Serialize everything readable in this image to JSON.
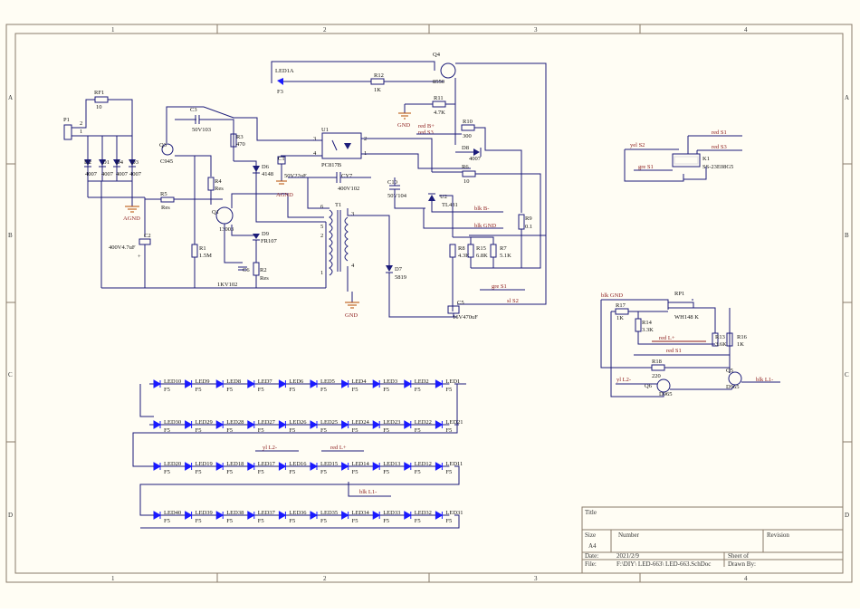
{
  "colors": {
    "paper": "#fffdf4",
    "border": "#8a7a6a",
    "wire": "#1c1c7a",
    "net_label": "#8b1a1a",
    "led": "#1a1aff",
    "gnd": "#b44a00"
  },
  "border": {
    "cols": [
      "1",
      "2",
      "3",
      "4"
    ],
    "rows": [
      "A",
      "B",
      "C",
      "D"
    ]
  },
  "components": {
    "P1": "P1",
    "RF1": "RF1",
    "RF1_val": "10",
    "D2": "D2",
    "D1": "D1",
    "D4": "D4",
    "D3": "D3",
    "D_val": "4007",
    "C2": "C2",
    "C2_val": "400V4.7uF",
    "R5": "R5",
    "R5_val": "Res",
    "Q3": "Q3",
    "Q3_val": "C945",
    "C3": "C3",
    "C3_val": "50V103",
    "R3": "R3",
    "R3_val": "470",
    "R4": "R4",
    "R4_val": "Res",
    "Q1": "Q1",
    "Q1_val": "13003",
    "R1": "R1",
    "R1_val": "1.5M",
    "C6": "C6",
    "C6_val": "1KV102",
    "R2": "R2",
    "R2_val": "Res",
    "D6": "D6",
    "D6_val": "4148",
    "D9": "D9",
    "D9_val": "FR107",
    "LED1A": "LED1A",
    "LED1A_val": "F3",
    "R12": "R12",
    "R12_val": "1K",
    "Q4": "Q4",
    "Q4_val": "8550",
    "R11": "R11",
    "R11_val": "4.7K",
    "R10": "R10",
    "R10_val": "300",
    "D8": "D8",
    "D8_val": "4007",
    "R6": "R6",
    "R6_val": "10",
    "U1": "U1",
    "U1_val": "PC817B",
    "C1": "C1",
    "C1_val": "50V22uF",
    "CY7": "CY7",
    "CY7_val": "400V102",
    "C10": "C10",
    "C10_val": "50V104",
    "U2": "U2",
    "U2_val": "TL431",
    "T1": "T1",
    "D7": "D7",
    "D7_val": "5819",
    "R8": "R8",
    "R8_val": "4.3K",
    "R15": "R15",
    "R15_val": "6.8K",
    "R7": "R7",
    "R7_val": "5.1K",
    "R9": "R9",
    "R9_val": "0.1",
    "C5": "C5",
    "C5_val": "16V470uF",
    "K1": "K1",
    "K1_val": "SS-23E08G5",
    "R17": "R17",
    "R17_val": "1K",
    "RP1": "RP1",
    "RP1_val": "WH148 K",
    "R14": "R14",
    "R14_val": "3.3K",
    "R13": "R13",
    "R13_val": "3.6K",
    "R16": "R16",
    "R16_val": "1K",
    "R18": "R18",
    "R18_val": "220",
    "Q5": "Q5",
    "Q5_val": "D965",
    "Q6": "Q6",
    "Q6_val": "D965"
  },
  "nets": {
    "agnd": "AGND",
    "gnd": "GND",
    "red_b_plus": "red B+",
    "red_s3": "red S3",
    "red_s1": "red S1",
    "yel_s2": "yel S2",
    "gre_s1": "gre S1",
    "blk_b_minus": "blk B-",
    "blk_gnd": "blk GND",
    "sl_s2": "sl S2",
    "blk_l1_minus": "blk L1-",
    "yl_l2_minus": "yl L2-",
    "red_l_plus": "red L+"
  },
  "transformer_pins": [
    "6",
    "5",
    "2",
    "1",
    "3",
    "4"
  ],
  "optocoupler_pins": [
    "3",
    "4",
    "2",
    "1"
  ],
  "pin_numbers": [
    "2",
    "1"
  ],
  "led_rows": [
    {
      "labels": [
        "LED10",
        "LED9",
        "LED8",
        "LED7",
        "LED6",
        "LED5",
        "LED4",
        "LED3",
        "LED2",
        "LED1"
      ],
      "val": "F5"
    },
    {
      "labels": [
        "LED30",
        "LED29",
        "LED28",
        "LED27",
        "LED26",
        "LED25",
        "LED24",
        "LED23",
        "LED22",
        "LED21"
      ],
      "val": "F5"
    },
    {
      "labels": [
        "LED20",
        "LED19",
        "LED18",
        "LED17",
        "LED16",
        "LED15",
        "LED14",
        "LED13",
        "LED12",
        "LED11"
      ],
      "val": "F5"
    },
    {
      "labels": [
        "LED40",
        "LED39",
        "LED38",
        "LED37",
        "LED36",
        "LED35",
        "LED34",
        "LED33",
        "LED32",
        "LED31"
      ],
      "val": "F5"
    }
  ],
  "title_block": {
    "title": "Title",
    "size": "Size",
    "size_val": "A4",
    "number": "Number",
    "revision": "Revision",
    "date": "Date:",
    "date_val": "2021/2/9",
    "sheet": "Sheet  of",
    "file": "File:",
    "file_val": "F:\\DIY\\    LED-663\\    LED-663.SchDoc",
    "drawn_by": "Drawn By:"
  }
}
